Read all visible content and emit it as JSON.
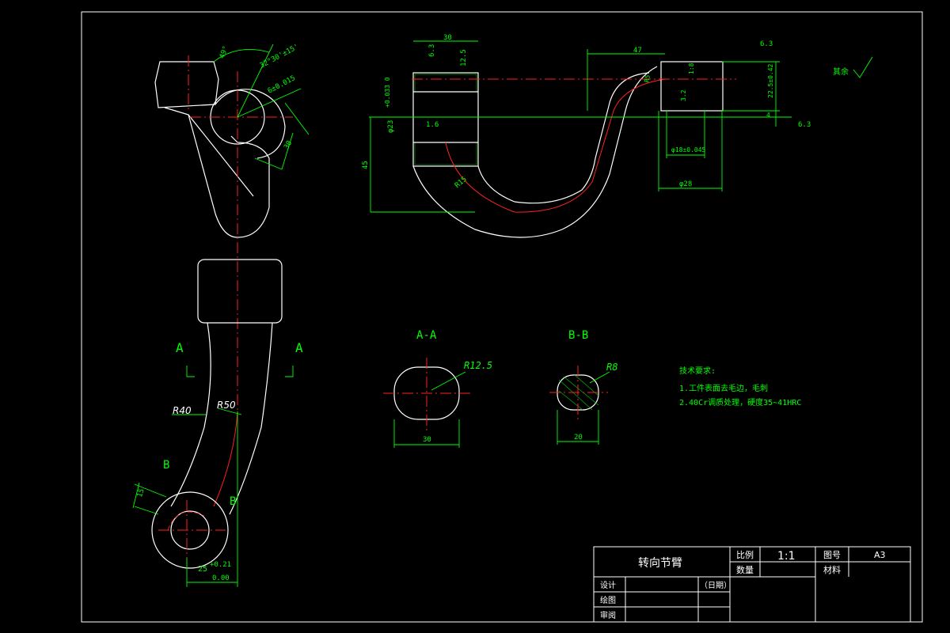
{
  "title_block": {
    "part_name": "转向节臂",
    "scale_label": "比例",
    "scale_value": "1:1",
    "drawing_no_label": "图号",
    "sheet_size": "A3",
    "quantity_label": "数量",
    "material_label": "材料",
    "design_label": "设计",
    "date_label": "（日期）",
    "drawn_label": "绘图",
    "review_label": "审阅"
  },
  "sections": {
    "aa_label": "A-A",
    "bb_label": "B-B",
    "aa_radius": "R12.5",
    "aa_width": "30",
    "bb_radius": "R8",
    "bb_width": "20"
  },
  "front_view": {
    "angle_a": "49°",
    "angle_tol": "32°30'±15'",
    "taper": "6±0.015",
    "dim_30": "30",
    "letter_a_left": "A",
    "letter_a_right": "A",
    "r40": "R40",
    "r50": "R50",
    "letter_b_left": "B",
    "letter_b_right": "B",
    "dim_15": "15",
    "dim_25": "25",
    "dim_25_tol_up": "+0.21",
    "dim_25_tol_dn": "0.00"
  },
  "top_view": {
    "dim_30": "30",
    "rough_63a": "6.3",
    "dim_12_5": "12.5",
    "rough_16": "1.6",
    "dim_phi23": "φ23",
    "dim_phi23_tol": "+0.033\n0",
    "dim_45": "45",
    "dim_r15": "R15",
    "dim_47": "47",
    "dim_r5": "R5",
    "taper_18": "1:8",
    "dim_32": "3.2",
    "rough_63b": "6.3",
    "dim_22": "22.5±0.42",
    "dim_4": "4",
    "rough_63c": "6.3",
    "dim_phi18": "φ18±0.045",
    "dim_phi28": "φ28",
    "rest_note": "其余"
  },
  "notes": {
    "heading": "技术要求:",
    "line1": "1.工件表面去毛边，毛刺",
    "line2": "2.40Cr调质处理，硬度35~41HRC"
  }
}
